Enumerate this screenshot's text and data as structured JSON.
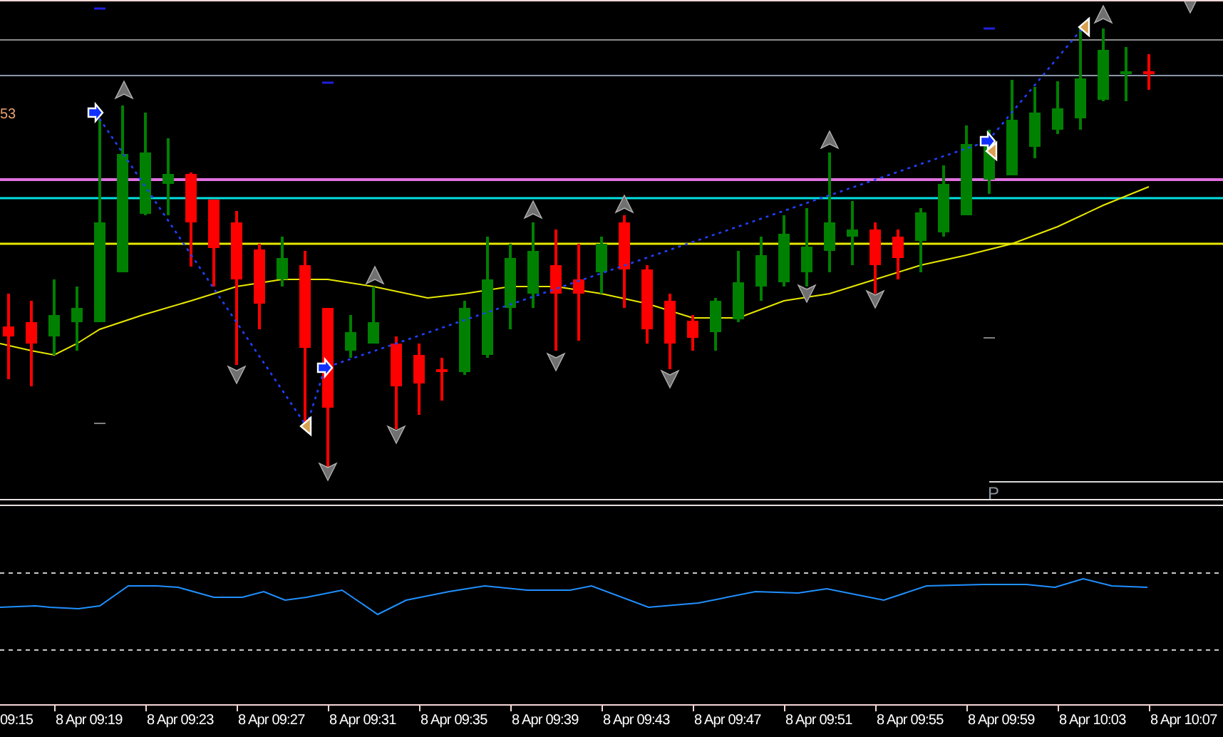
{
  "chart": {
    "price_label": "53",
    "marker_label": "P"
  },
  "time_axis": {
    "labels": [
      "09:15",
      "8 Apr 09:19",
      "8 Apr 09:23",
      "8 Apr 09:27",
      "8 Apr 09:31",
      "8 Apr 09:35",
      "8 Apr 09:39",
      "8 Apr 09:43",
      "8 Apr 09:47",
      "8 Apr 09:51",
      "8 Apr 09:55",
      "8 Apr 09:59",
      "8 Apr 10:03",
      "8 Apr 10:07"
    ]
  }
}
